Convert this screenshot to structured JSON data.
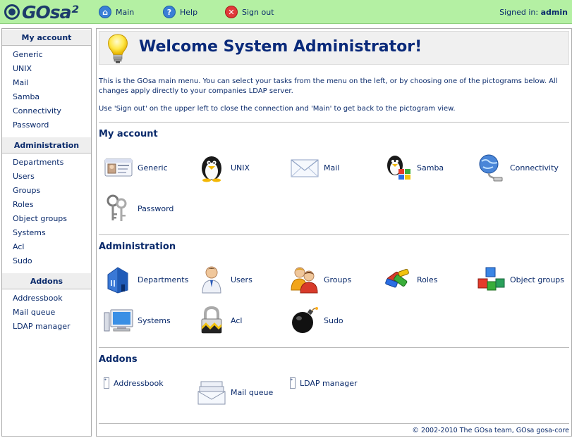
{
  "header": {
    "logo_text": "GOsa²",
    "nav": [
      {
        "label": "Main",
        "icon": "home-icon"
      },
      {
        "label": "Help",
        "icon": "help-icon"
      },
      {
        "label": "Sign out",
        "icon": "sign-out-icon"
      }
    ],
    "signed_in_label": "Signed in:",
    "user": "admin"
  },
  "sidebar": {
    "sections": [
      {
        "title": "My account",
        "items": [
          "Generic",
          "UNIX",
          "Mail",
          "Samba",
          "Connectivity",
          "Password"
        ]
      },
      {
        "title": "Administration",
        "items": [
          "Departments",
          "Users",
          "Groups",
          "Roles",
          "Object groups",
          "Systems",
          "Acl",
          "Sudo"
        ]
      },
      {
        "title": "Addons",
        "items": [
          "Addressbook",
          "Mail queue",
          "LDAP manager"
        ]
      }
    ]
  },
  "main": {
    "welcome": "Welcome System Administrator!",
    "intro1": "This is the GOsa main menu. You can select your tasks from the menu on the left, or by choosing one of the pictograms below. All changes apply directly to your companies LDAP server.",
    "intro2": "Use 'Sign out' on the upper left to close the connection and 'Main' to get back to the pictogram view.",
    "sections": [
      {
        "title": "My account",
        "tiles": [
          {
            "label": "Generic",
            "icon": "id-card-icon"
          },
          {
            "label": "UNIX",
            "icon": "penguin-icon"
          },
          {
            "label": "Mail",
            "icon": "envelope-icon"
          },
          {
            "label": "Samba",
            "icon": "penguin-windows-icon"
          },
          {
            "label": "Connectivity",
            "icon": "globe-connectivity-icon"
          },
          {
            "label": "Password",
            "icon": "keys-icon"
          }
        ]
      },
      {
        "title": "Administration",
        "tiles": [
          {
            "label": "Departments",
            "icon": "building-icon"
          },
          {
            "label": "Users",
            "icon": "user-icon"
          },
          {
            "label": "Groups",
            "icon": "group-icon"
          },
          {
            "label": "Roles",
            "icon": "roles-icon"
          },
          {
            "label": "Object groups",
            "icon": "cubes-icon"
          },
          {
            "label": "Systems",
            "icon": "computer-icon"
          },
          {
            "label": "Acl",
            "icon": "padlock-icon"
          },
          {
            "label": "Sudo",
            "icon": "bomb-icon"
          }
        ]
      },
      {
        "title": "Addons",
        "tiles": [
          {
            "label": "Addressbook",
            "icon": "addressbook-icon"
          },
          {
            "label": "Mail queue",
            "icon": "mail-queue-icon"
          },
          {
            "label": "LDAP manager",
            "icon": "ldap-manager-icon"
          }
        ]
      }
    ]
  },
  "footer": "© 2002-2010 The GOsa team, GOsa gosa-core",
  "colors": {
    "topbar": "#b4f0a3",
    "link": "#0a2a6b",
    "title": "#0a2a7a"
  }
}
